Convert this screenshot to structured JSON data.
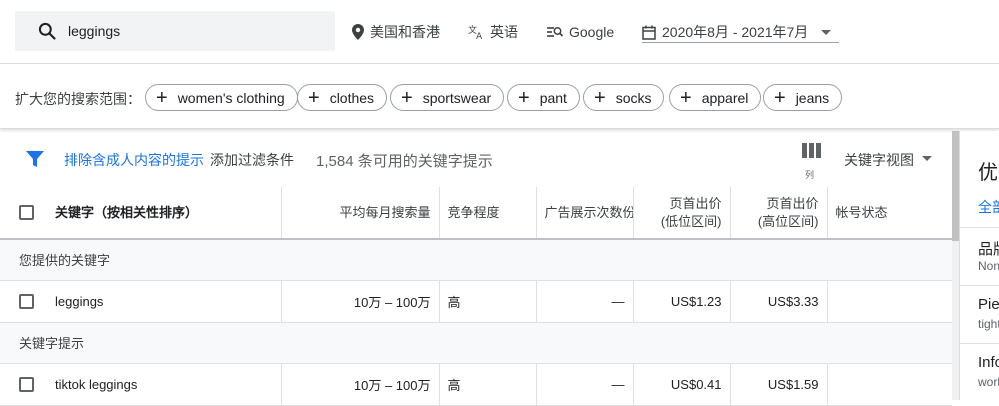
{
  "search": {
    "value": "leggings",
    "icon": "search-icon"
  },
  "top_filters": {
    "location": "美国和香港",
    "language": "英语",
    "network": "Google",
    "date_range": "2020年8月 - 2021年7月"
  },
  "broaden": {
    "label": "扩大您的搜索范围：",
    "chips": [
      "women's clothing",
      "clothes",
      "sportswear",
      "pant",
      "socks",
      "apparel",
      "jeans"
    ]
  },
  "toolbar": {
    "exclude_adult": "排除含成人内容的提示",
    "add_filter": "添加过滤条件",
    "count": "1,584 条可用的关键字提示",
    "columns_label": "列",
    "view_label": "关键字视图"
  },
  "table": {
    "headers": {
      "keyword": "关键字（按相关性排序）",
      "avg_searches": "平均每月搜索量",
      "competition": "竞争程度",
      "impression_share": "广告展示次数份",
      "bid_low_1": "页首出价",
      "bid_low_2": "(低位区间)",
      "bid_high_1": "页首出价",
      "bid_high_2": "(高位区间)",
      "account_status": "帐号状态"
    },
    "group_provided": "您提供的关键字",
    "group_ideas": "关键字提示",
    "rows": [
      {
        "keyword": "leggings",
        "searches": "10万 – 100万",
        "competition": "高",
        "share": "—",
        "bid_low": "US$1.23",
        "bid_high": "US$3.33",
        "status": ""
      },
      {
        "keyword": "tiktok leggings",
        "searches": "10万 – 100万",
        "competition": "高",
        "share": "—",
        "bid_low": "US$0.41",
        "bid_high": "US$1.59",
        "status": ""
      }
    ]
  },
  "side_panel": {
    "title": "优化",
    "all": "全部",
    "items": [
      {
        "title": "品牌",
        "sub": "None"
      },
      {
        "title": "Piece",
        "sub": "tight"
      },
      {
        "title": "Info",
        "sub": "work"
      }
    ]
  },
  "colors": {
    "accent": "#1a73e8",
    "border": "#dadce0",
    "text": "#202124"
  }
}
